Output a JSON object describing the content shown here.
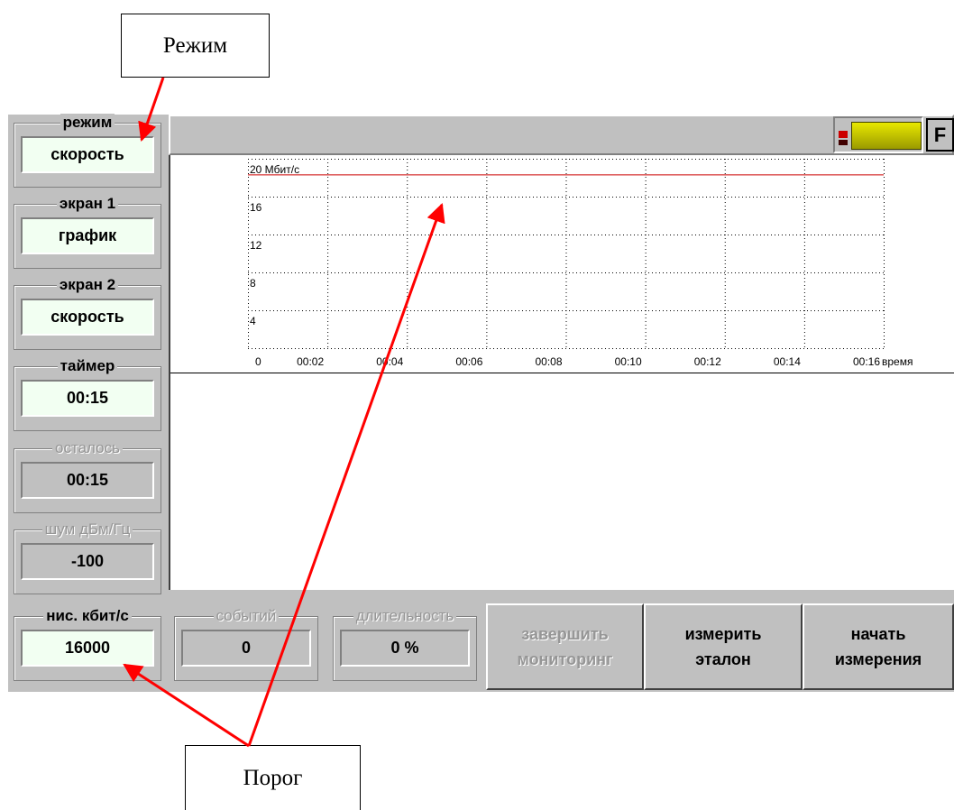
{
  "callouts": {
    "mode": "Режим",
    "threshold": "Порог"
  },
  "sidebar": {
    "groups": [
      {
        "label": "режим",
        "value": "скорость",
        "enabled": true
      },
      {
        "label": "экран 1",
        "value": "график",
        "enabled": true
      },
      {
        "label": "экран 2",
        "value": "скорость",
        "enabled": true
      },
      {
        "label": "таймер",
        "value": "00:15",
        "enabled": true
      },
      {
        "label": "осталось",
        "value": "00:15",
        "enabled": false
      },
      {
        "label": "шум дБм/Гц",
        "value": "-100",
        "enabled": false
      }
    ]
  },
  "bottom": {
    "threshold": {
      "label": "нис. кбит/с",
      "value": "16000"
    },
    "events": {
      "label": "событий",
      "value": "0"
    },
    "duration": {
      "label": "длительность",
      "value": "0 %"
    },
    "buttons": {
      "stop_monitoring": [
        "завершить",
        "мониторинг"
      ],
      "measure_reference": [
        "измерить",
        "эталон"
      ],
      "start_measurement": [
        "начать",
        "измерения"
      ]
    }
  },
  "topbar": {
    "f_label": "F"
  },
  "colors": {
    "threshold_line": "#cc0000",
    "battery": "#c8c800",
    "arrow": "#ff0000"
  },
  "chart_data": {
    "type": "line",
    "y_ticks": [
      "4",
      "8",
      "12",
      "16",
      "20 Мбит/с"
    ],
    "x_ticks": [
      "0",
      "00:02",
      "00:04",
      "00:06",
      "00:08",
      "00:10",
      "00:12",
      "00:14",
      "00:16"
    ],
    "xlabel": "время",
    "ylim": [
      0,
      20
    ],
    "xlim": [
      0,
      16
    ],
    "threshold_line": {
      "y": 18.3
    },
    "grid": true
  }
}
